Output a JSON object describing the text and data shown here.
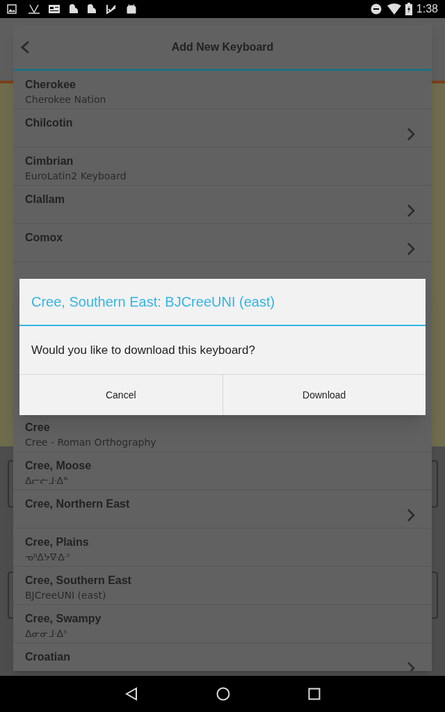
{
  "status_bar": {
    "time": "1:38"
  },
  "header": {
    "title": "Add New Keyboard"
  },
  "keyboards": [
    {
      "name": "Cherokee",
      "subtitle": "Cherokee Nation",
      "expandable": false
    },
    {
      "name": "Chilcotin",
      "expandable": true
    },
    {
      "name": "Cimbrian",
      "subtitle": "EuroLatin2 Keyboard",
      "expandable": false
    },
    {
      "name": "Clallam",
      "expandable": true
    },
    {
      "name": "Comox",
      "expandable": true,
      "hidden_after": true
    },
    {
      "name": "Cree",
      "subtitle": "Cree - Roman Orthography",
      "expandable": false
    },
    {
      "name": "Cree, Moose",
      "subtitle": "ᐃᓕᓖᒧᐧᐃᓐ",
      "expandable": false
    },
    {
      "name": "Cree, Northern East",
      "expandable": true
    },
    {
      "name": "Cree, Plains",
      "subtitle": "ᓀᐦᐃᔭᐍᐏᐣ",
      "expandable": false
    },
    {
      "name": "Cree, Southern East",
      "subtitle": "BJCreeUNI (east)",
      "expandable": false
    },
    {
      "name": "Cree, Swampy",
      "subtitle": "ᐃᓂᓂᒧᐧᐃᐣ",
      "expandable": false
    },
    {
      "name": "Croatian",
      "expandable": true
    }
  ],
  "dialog": {
    "title": "Cree, Southern East: BJCreeUNI (east)",
    "message": "Would you like to download this keyboard?",
    "buttons": [
      "Cancel",
      "Download"
    ]
  }
}
